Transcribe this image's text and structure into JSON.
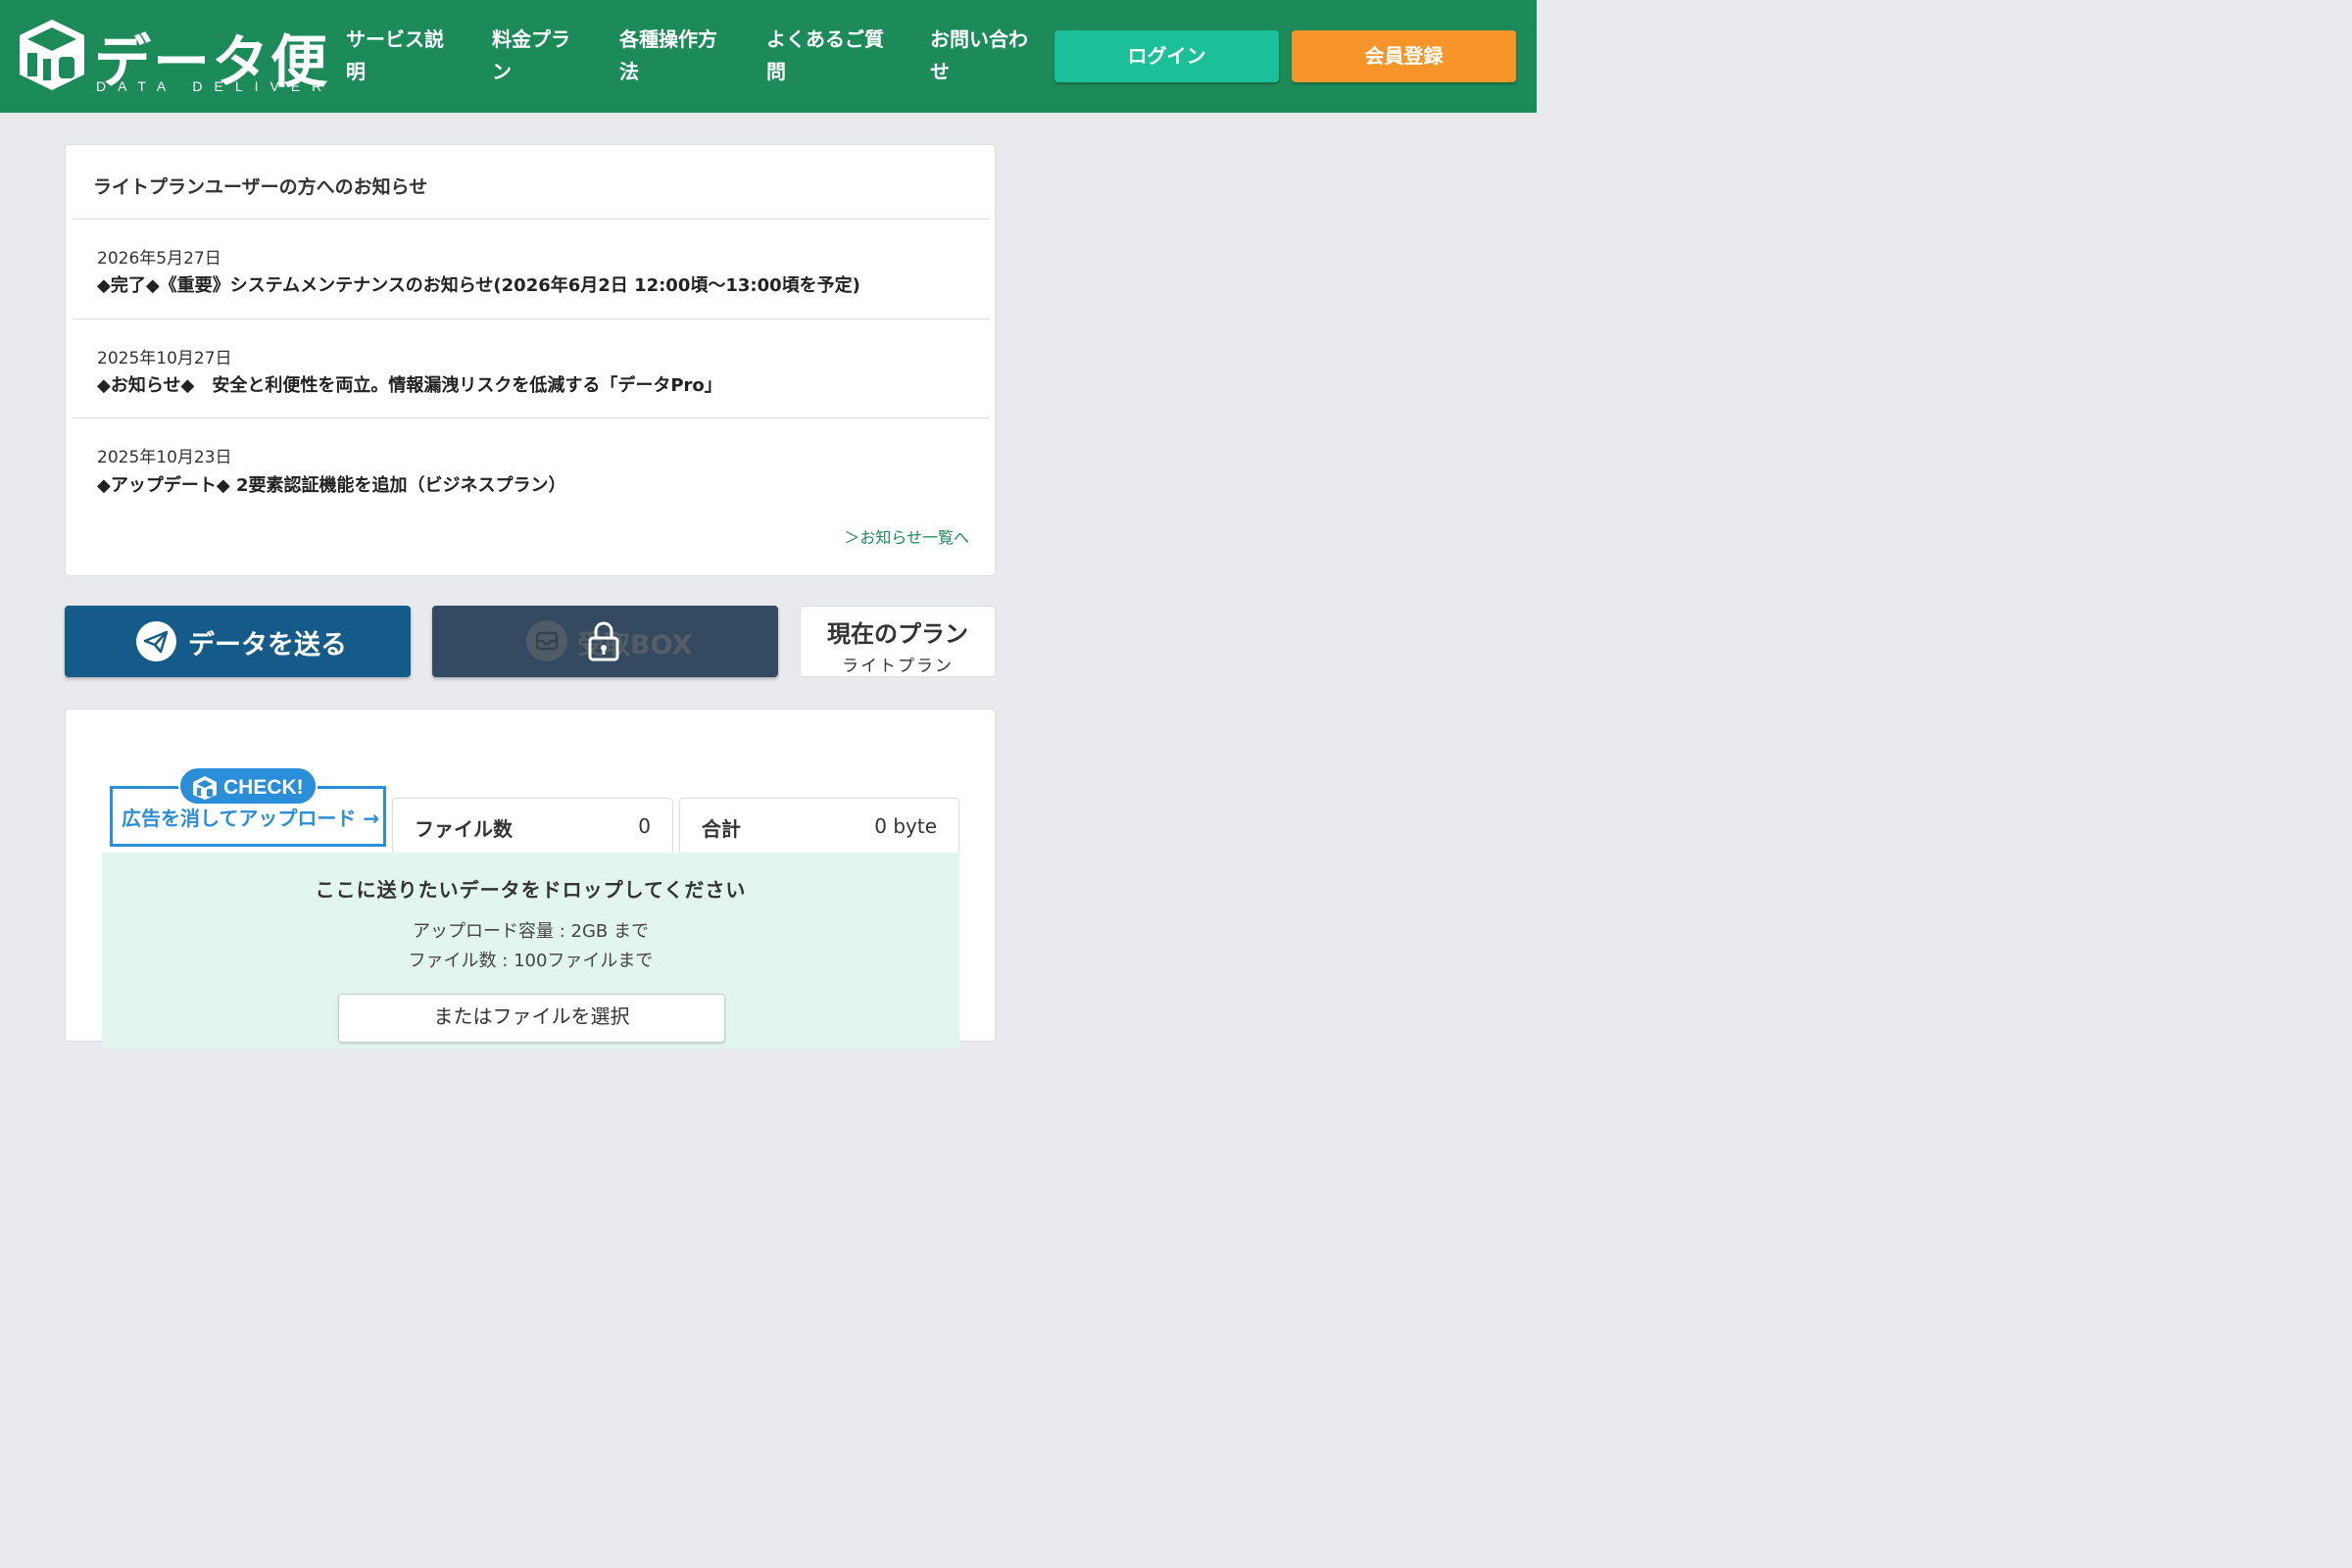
{
  "header": {
    "logo_text": "データ便",
    "logo_sub": "DATA DELIVER",
    "nav": [
      {
        "line1": "サービス説",
        "line2": "明"
      },
      {
        "line1": "料金プラ",
        "line2": "ン"
      },
      {
        "line1": "各種操作方",
        "line2": "法"
      },
      {
        "line1": "よくあるご質",
        "line2": "問"
      },
      {
        "line1": "お問い合わ",
        "line2": "せ"
      }
    ],
    "login_label": "ログイン",
    "register_label": "会員登録",
    "colors": {
      "bar": "#1d8a5a",
      "login": "#1bbf98",
      "register": "#f7952b"
    }
  },
  "news": {
    "title": "ライトプランユーザーの方へのお知らせ",
    "items": [
      {
        "date": "2026年5月27日",
        "text": "◆完了◆《重要》システムメンテナンスのお知らせ(2026年6月2日 12:00頃〜13:00頃を予定)"
      },
      {
        "date": "2025年10月27日",
        "text": "◆お知らせ◆　安全と利便性を両立。情報漏洩リスクを低減する「データPro」"
      },
      {
        "date": "2025年10月23日",
        "text": "◆アップデート◆ 2要素認証機能を追加（ビジネスプラン）"
      }
    ],
    "more_link": "＞お知らせ一覧へ"
  },
  "actions": {
    "send_label": "データを送る",
    "box_label": "受取BOX",
    "plan_title": "現在のプラン",
    "plan_name": "ライトプラン"
  },
  "upload": {
    "check_badge": "CHECK!",
    "check_text": "広告を消してアップロード →",
    "file_count_label": "ファイル数",
    "file_count_value": "0",
    "total_label": "合計",
    "total_value": "0 byte",
    "drop_title": "ここに送りたいデータをドロップしてください",
    "limit_size": "アップロード容量 : 2GB まで",
    "limit_files": "ファイル数 : 100ファイルまで",
    "select_label": "またはファイルを選択"
  }
}
